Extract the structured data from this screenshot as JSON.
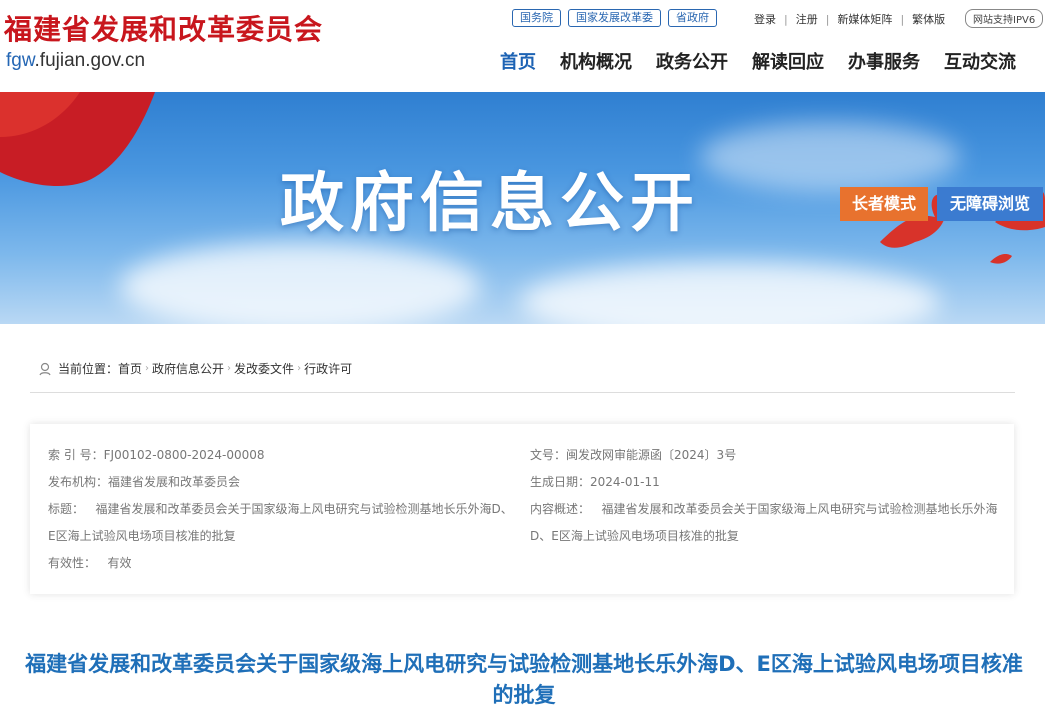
{
  "header": {
    "logo_cn": "福建省发展和改革委员会",
    "logo_en_prefix": "fgw",
    "logo_en_suffix": ".fujian.gov.cn",
    "top_links": [
      "国务院",
      "国家发展改革委",
      "省政府"
    ],
    "user_links": [
      "登录",
      "注册",
      "新媒体矩阵",
      "繁体版"
    ],
    "ipv6": "网站支持IPV6",
    "nav": [
      "首页",
      "机构概况",
      "政务公开",
      "解读回应",
      "办事服务",
      "互动交流"
    ],
    "nav_active": "首页"
  },
  "banner": {
    "title": "政府信息公开",
    "elder_mode": "长者模式",
    "accessible": "无障碍浏览"
  },
  "breadcrumb": {
    "label": "当前位置：",
    "items": [
      "首页",
      "政府信息公开",
      "发改委文件",
      "行政许可"
    ]
  },
  "meta": {
    "index_label": "索 引 号：",
    "index_value": "FJ00102-0800-2024-00008",
    "org_label": "发布机构：",
    "org_value": "福建省发展和改革委员会",
    "title_label": "标题：",
    "title_value": "福建省发展和改革委员会关于国家级海上风电研究与试验检测基地长乐外海D、E区海上试验风电场项目核准的批复",
    "validity_label": "有效性：",
    "validity_value": "有效",
    "docno_label": "文号：",
    "docno_value": "闽发改网审能源函〔2024〕3号",
    "date_label": "生成日期：",
    "date_value": "2024-01-11",
    "summary_label": "内容概述：",
    "summary_value": "福建省发展和改革委员会关于国家级海上风电研究与试验检测基地长乐外海D、E区海上试验风电场项目核准的批复"
  },
  "document": {
    "title": "福建省发展和改革委员会关于国家级海上风电研究与试验检测基地长乐外海D、E区海上试验风电场项目核准的批复"
  },
  "colors": {
    "brand_red": "#c8161d",
    "brand_blue": "#1d63b4",
    "elder_orange": "#e8722e"
  }
}
